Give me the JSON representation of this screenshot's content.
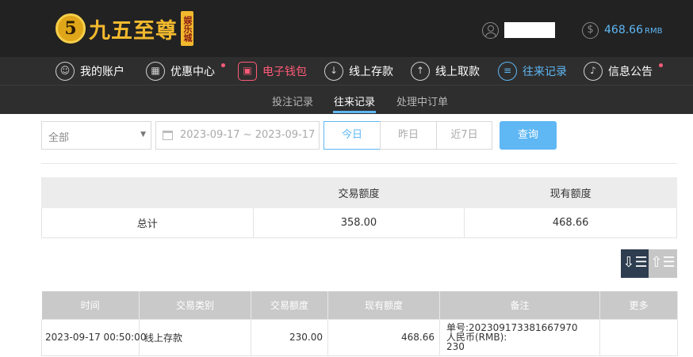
{
  "brand": {
    "logo_mark": "5",
    "name": "九五至尊",
    "tag": "娱乐城",
    "logo_color": "#f2b92e"
  },
  "account": {
    "user_icon": "user-icon",
    "balance_icon": "dollar-circle-icon",
    "balance": "468.66",
    "currency": "RMB"
  },
  "main_nav": [
    {
      "label": "我的账户",
      "icon": "user-icon",
      "state": "normal",
      "dot": false
    },
    {
      "label": "优惠中心",
      "icon": "gift-icon",
      "state": "normal",
      "dot": true
    },
    {
      "label": "电子钱包",
      "icon": "wallet-icon",
      "state": "active-red",
      "dot": false
    },
    {
      "label": "线上存款",
      "icon": "deposit-icon",
      "state": "normal",
      "dot": false
    },
    {
      "label": "线上取款",
      "icon": "withdraw-icon",
      "state": "normal",
      "dot": false
    },
    {
      "label": "往来记录",
      "icon": "records-icon",
      "state": "active-blue",
      "dot": false
    },
    {
      "label": "信息公告",
      "icon": "bell-icon",
      "state": "normal",
      "dot": true
    }
  ],
  "sub_nav": [
    {
      "label": "投注记录",
      "active": false
    },
    {
      "label": "往来记录",
      "active": true
    },
    {
      "label": "处理中订单",
      "active": false
    }
  ],
  "filters": {
    "type_select": "全部",
    "date_range": "2023-09-17 ~ 2023-09-17",
    "quick_ranges": [
      "今日",
      "昨日",
      "近7日"
    ],
    "active_range": "今日",
    "query_label": "查询"
  },
  "summary": {
    "headers": [
      "",
      "交易额度",
      "现有额度"
    ],
    "row": [
      "总计",
      "358.00",
      "468.66"
    ]
  },
  "records": {
    "headers": [
      "时间",
      "交易类别",
      "交易额度",
      "现有额度",
      "备注",
      "更多"
    ],
    "rows": [
      {
        "time": "2023-09-17 00:50:00",
        "type": "线上存款",
        "amount": "230.00",
        "balance": "468.66",
        "remark_lines": [
          "单号:20230917338166797​0",
          "人民币(RMB):",
          "230"
        ],
        "more": ""
      }
    ]
  },
  "colors": {
    "accent_blue": "#5fb7f4",
    "accent_red": "#ff5b78",
    "header_bg": "#222222",
    "nav_bg": "#2e2e2e"
  }
}
